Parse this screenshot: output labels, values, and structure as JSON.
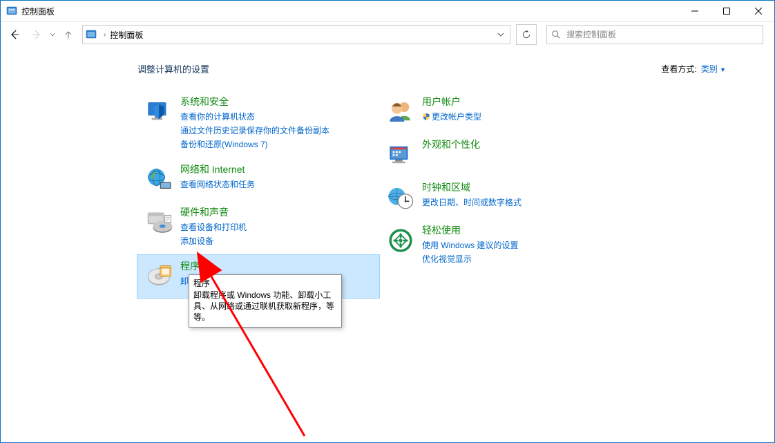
{
  "window": {
    "title": "控制面板",
    "controls": {
      "minimize": "min",
      "maximize": "max",
      "close": "close"
    }
  },
  "nav": {
    "breadcrumb": "控制面板",
    "search_placeholder": "搜索控制面板"
  },
  "page": {
    "title": "调整计算机的设置",
    "view_by_label": "查看方式:",
    "view_by_value": "类别"
  },
  "categories_left": [
    {
      "id": "system-security",
      "title": "系统和安全",
      "icon": "shield-icon",
      "links": [
        "查看你的计算机状态",
        "通过文件历史记录保存你的文件备份副本",
        "备份和还原(Windows 7)"
      ]
    },
    {
      "id": "network-internet",
      "title": "网络和 Internet",
      "icon": "network-icon",
      "links": [
        "查看网络状态和任务"
      ]
    },
    {
      "id": "hardware-sound",
      "title": "硬件和声音",
      "icon": "hardware-icon",
      "links": [
        "查看设备和打印机",
        "添加设备"
      ]
    },
    {
      "id": "programs",
      "title": "程序",
      "icon": "programs-icon",
      "hovered": true,
      "links": [
        "卸载程序"
      ]
    }
  ],
  "categories_right": [
    {
      "id": "user-accounts",
      "title": "用户帐户",
      "icon": "users-icon",
      "links": [
        {
          "shield": true,
          "text": "更改帐户类型"
        }
      ]
    },
    {
      "id": "appearance",
      "title": "外观和个性化",
      "icon": "appearance-icon",
      "links": []
    },
    {
      "id": "clock-region",
      "title": "时钟和区域",
      "icon": "clock-icon",
      "links": [
        "更改日期、时间或数字格式"
      ]
    },
    {
      "id": "ease-of-access",
      "title": "轻松使用",
      "icon": "ease-icon",
      "links": [
        "使用 Windows 建议的设置",
        "优化视觉显示"
      ]
    }
  ],
  "tooltip": {
    "title": "程序",
    "body": "卸载程序或 Windows 功能、卸载小工具、从网络或通过联机获取新程序，等等。"
  },
  "colors": {
    "link": "#0066cc",
    "heading": "#128b12",
    "accent": "#0a75c2",
    "hover_bg": "#cce8ff"
  }
}
